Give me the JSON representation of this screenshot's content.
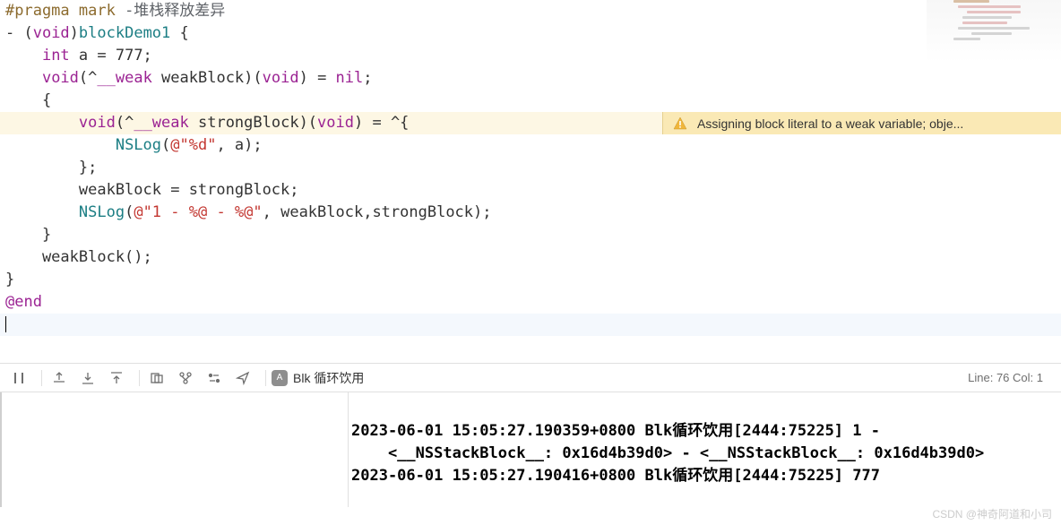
{
  "code": {
    "l1_pragma": "#pragma mark ",
    "l1_comment": "-堆栈释放差异",
    "l2a": "- (",
    "l2b": "void",
    "l2c": ")",
    "l2d": "blockDemo1",
    "l2e": " {",
    "l3a": "    ",
    "l3b": "int",
    "l3c": " a = 777;",
    "l4a": "    ",
    "l4b": "void",
    "l4c": "(^",
    "l4d": "__weak",
    "l4e": " weakBlock)(",
    "l4f": "void",
    "l4g": ") = ",
    "l4h": "nil",
    "l4i": ";",
    "l5": "    {",
    "l6a": "        ",
    "l6b": "void",
    "l6c": "(^",
    "l6d": "__weak",
    "l6e": " strongBlock)(",
    "l6f": "void",
    "l6g": ") = ^{",
    "l7a": "            ",
    "l7b": "NSLog",
    "l7c": "(",
    "l7d": "@\"%d\"",
    "l7e": ", a);",
    "l8": "        };",
    "l9": "        weakBlock = strongBlock;",
    "l10a": "        ",
    "l10b": "NSLog",
    "l10c": "(",
    "l10d": "@\"1 - %@ - %@\"",
    "l10e": ", weakBlock,strongBlock);",
    "l11": "    }",
    "l12": "    weakBlock();",
    "l13": "}",
    "l14": "@end"
  },
  "warning": {
    "text": "Assigning block literal to a weak variable; obje..."
  },
  "toolbar": {
    "scheme_letter": "A",
    "scheme_name": "Blk 循环饮用",
    "line_label": "Line: ",
    "line": "76",
    "col_label": "  Col: ",
    "col": "1"
  },
  "console": {
    "line1": "2023-06-01 15:05:27.190359+0800 Blk循环饮用[2444:75225] 1 -",
    "line2": "    <__NSStackBlock__: 0x16d4b39d0> - <__NSStackBlock__: 0x16d4b39d0>",
    "line3": "2023-06-01 15:05:27.190416+0800 Blk循环饮用[2444:75225] 777"
  },
  "watermark": "CSDN @神奇阿道和小司"
}
